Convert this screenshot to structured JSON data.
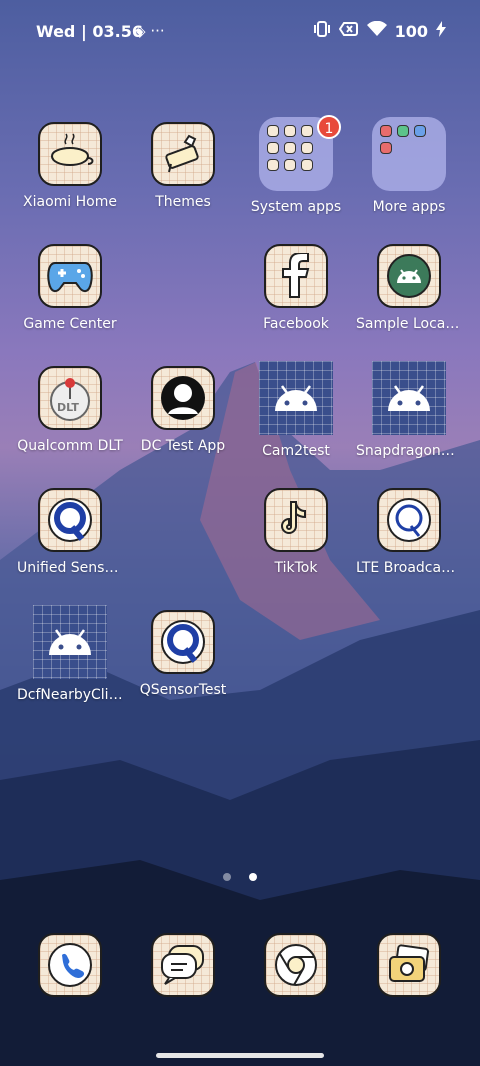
{
  "status_bar": {
    "time": "Wed | 03.56",
    "more": "···",
    "battery": "100"
  },
  "apps": [
    {
      "label": "Xiaomi Home"
    },
    {
      "label": "Themes"
    },
    {
      "label": "System apps",
      "badge": "1"
    },
    {
      "label": "More apps"
    },
    {
      "label": "Game Center"
    },
    {
      "label": "Facebook"
    },
    {
      "label": "Sample Locati…"
    },
    {
      "label": "Qualcomm DLT"
    },
    {
      "label": "DC Test App"
    },
    {
      "label": "Cam2test"
    },
    {
      "label": "SnapdragonSD…"
    },
    {
      "label": "Unified Sensor …"
    },
    {
      "label": "TikTok"
    },
    {
      "label": "LTE Broadcast …"
    },
    {
      "label": "DcfNearbyClie…"
    },
    {
      "label": "QSensorTest"
    }
  ],
  "page_indicator": {
    "pages": 2,
    "current": 2
  },
  "dock": [
    {
      "icon": "phone-icon"
    },
    {
      "icon": "messages-icon"
    },
    {
      "icon": "chrome-icon"
    },
    {
      "icon": "gallery-icon"
    }
  ]
}
